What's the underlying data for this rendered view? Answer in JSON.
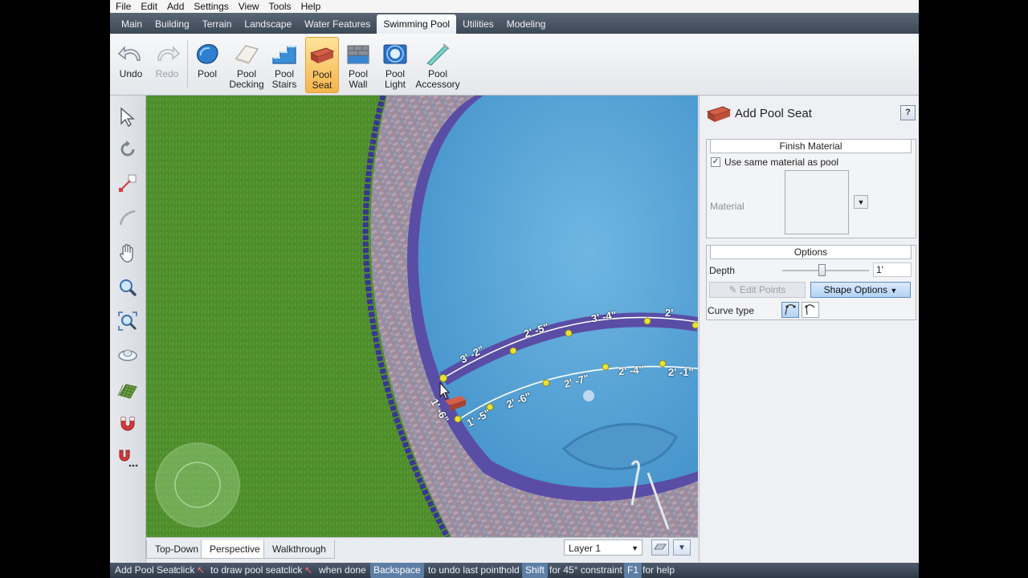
{
  "menu": [
    "File",
    "Edit",
    "Add",
    "Settings",
    "View",
    "Tools",
    "Help"
  ],
  "tabs": [
    {
      "label": "Main"
    },
    {
      "label": "Building"
    },
    {
      "label": "Terrain"
    },
    {
      "label": "Landscape"
    },
    {
      "label": "Water Features"
    },
    {
      "label": "Swimming Pool",
      "active": true
    },
    {
      "label": "Utilities"
    },
    {
      "label": "Modeling"
    }
  ],
  "ribbon": {
    "undo": "Undo",
    "redo": "Redo",
    "pool": "Pool",
    "pool_decking_1": "Pool",
    "pool_decking_2": "Decking",
    "pool_stairs_1": "Pool",
    "pool_stairs_2": "Stairs",
    "pool_seat_1": "Pool",
    "pool_seat_2": "Seat",
    "pool_wall_1": "Pool",
    "pool_wall_2": "Wall",
    "pool_light_1": "Pool",
    "pool_light_2": "Light",
    "pool_accessory_1": "Pool",
    "pool_accessory_2": "Accessory"
  },
  "viewport": {
    "dimensions": [
      "3' -2\"",
      "2' -5\"",
      "3' -4\"",
      "2'",
      "2' -7\"",
      "2' -4\"",
      "2' -1\"",
      "2' -6\"",
      "1' -5\"",
      "1' -6\""
    ]
  },
  "view_tabs": {
    "top_down": "Top-Down",
    "perspective": "Perspective",
    "walkthrough": "Walkthrough"
  },
  "layer": "Layer 1",
  "panel": {
    "title": "Add Pool Seat",
    "help": "?",
    "finish_material": "Finish Material",
    "use_same_material": "Use same material as pool",
    "use_same_checked": "✓",
    "material_label": "Material",
    "options": "Options",
    "depth_label": "Depth",
    "depth_value": "1'",
    "depth_slider": 0.45,
    "edit_points": "Edit Points",
    "shape_options": "Shape Options",
    "curve_type": "Curve type"
  },
  "status": {
    "mode": "Add Pool Seat",
    "click1": "click",
    "draw": "to draw pool seat",
    "click2": "click",
    "done": "when done",
    "backspace": "Backspace",
    "undo_last": "to undo last point",
    "hold": "hold",
    "shift": "Shift",
    "constraint": "for 45° constraint",
    "f1": "F1",
    "help": "for help"
  },
  "colors": {
    "grass": "#4f8d2c",
    "water": "#5aa5d6",
    "tile": "#5b4ea6",
    "ribbon_active": "#f6b44c"
  }
}
